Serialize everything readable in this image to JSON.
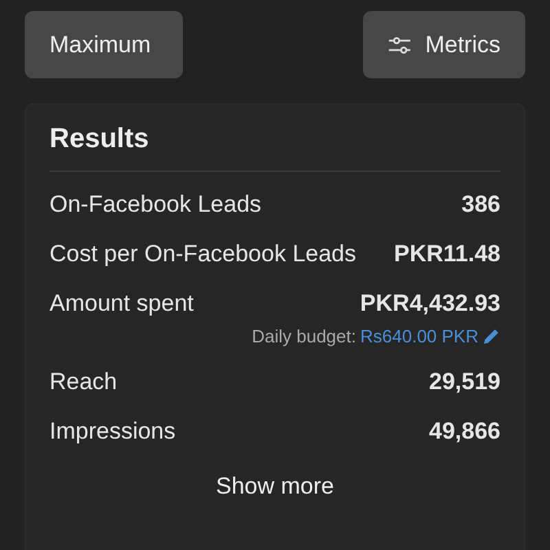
{
  "toolbar": {
    "bid_button": "Maximum",
    "metrics_button": "Metrics"
  },
  "results": {
    "title": "Results",
    "rows": [
      {
        "label": "On-Facebook Leads",
        "value": "386"
      },
      {
        "label": "Cost per On-Facebook Leads",
        "value": "PKR11.48"
      },
      {
        "label": "Amount spent",
        "value": "PKR4,432.93",
        "note_label": "Daily budget:",
        "note_link": "Rs640.00 PKR"
      },
      {
        "label": "Reach",
        "value": "29,519"
      },
      {
        "label": "Impressions",
        "value": "49,866"
      }
    ],
    "show_more": "Show more"
  }
}
